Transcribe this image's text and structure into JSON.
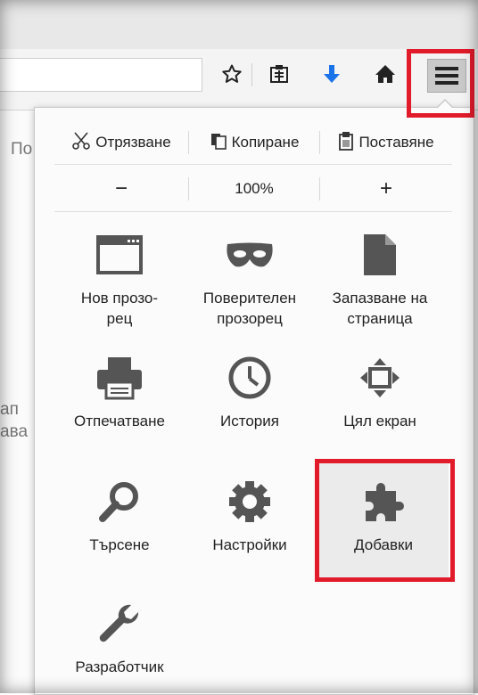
{
  "page": {
    "tab_partial": "По",
    "side_text_1": "ап",
    "side_text_2": "ава"
  },
  "toolbar": {
    "icons": [
      "bookmark-star-icon",
      "reading-list-icon",
      "download-icon",
      "home-icon",
      "hamburger-menu-icon"
    ],
    "accent_color": "#1a73e8",
    "highlight_color": "#e21b2a"
  },
  "menu": {
    "edit": {
      "cut": "Отрязване",
      "copy": "Копиране",
      "paste": "Поставяне"
    },
    "zoom": {
      "out": "−",
      "level": "100%",
      "in": "+"
    },
    "items": [
      {
        "label": "Нов прозо-\nрец",
        "icon": "new-window-icon"
      },
      {
        "label": "Поверителен\nпрозорец",
        "icon": "private-mask-icon"
      },
      {
        "label": "Запазване на\nстраница",
        "icon": "save-page-icon"
      },
      {
        "label": "Отпечатване",
        "icon": "print-icon"
      },
      {
        "label": "История",
        "icon": "history-clock-icon"
      },
      {
        "label": "Цял екран",
        "icon": "fullscreen-icon"
      },
      {
        "label": "Търсене",
        "icon": "search-icon"
      },
      {
        "label": "Настройки",
        "icon": "gear-icon"
      },
      {
        "label": "Добавки",
        "icon": "addons-puzzle-icon"
      },
      {
        "label": "Разработчик",
        "icon": "developer-wrench-icon"
      }
    ]
  }
}
